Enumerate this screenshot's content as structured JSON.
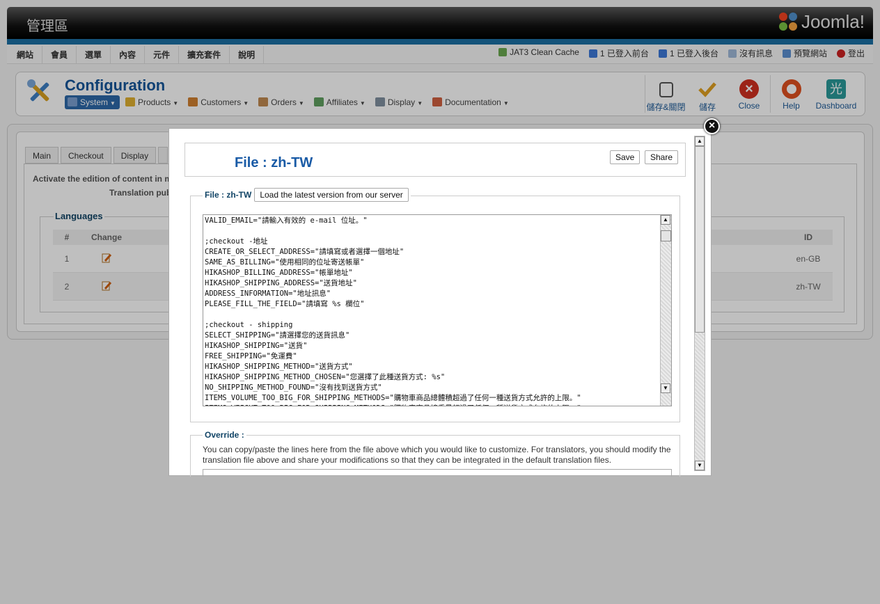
{
  "header": {
    "title": "管理區",
    "logo_text": "Joomla!"
  },
  "menu": [
    "網站",
    "會員",
    "選單",
    "內容",
    "元件",
    "擴充套件",
    "說明"
  ],
  "status": [
    {
      "label": "JAT3 Clean Cache",
      "color": "#6aa84f"
    },
    {
      "label": "1 已登入前台",
      "color": "#3c78d8"
    },
    {
      "label": "1 已登入後台",
      "color": "#3c78d8"
    },
    {
      "label": "沒有訊息",
      "color": "#9fb8d8"
    },
    {
      "label": "預覽網站",
      "color": "#5b8fd0"
    },
    {
      "label": "登出",
      "color": "#cc2222"
    }
  ],
  "config": {
    "title": "Configuration",
    "submenu": [
      {
        "label": "System",
        "active": true,
        "color": "#7a9fd0"
      },
      {
        "label": "Products",
        "active": false,
        "color": "#e0b030"
      },
      {
        "label": "Customers",
        "active": false,
        "color": "#d08030"
      },
      {
        "label": "Orders",
        "active": false,
        "color": "#c08a50"
      },
      {
        "label": "Affiliates",
        "active": false,
        "color": "#60a060"
      },
      {
        "label": "Display",
        "active": false,
        "color": "#8090a0"
      },
      {
        "label": "Documentation",
        "active": false,
        "color": "#d06040"
      }
    ],
    "buttons": [
      {
        "label": "儲存&關閉",
        "icon": "save-close-icon",
        "color": "#555"
      },
      {
        "label": "儲存",
        "icon": "save-icon",
        "color": "#e0a020"
      },
      {
        "label": "Close",
        "icon": "close-icon",
        "color": "#d03020"
      },
      {
        "label": "Help",
        "icon": "help-icon",
        "color": "#e05020"
      },
      {
        "label": "Dashboard",
        "icon": "dashboard-icon",
        "color": "#2a9a9a"
      }
    ]
  },
  "page_tabs": [
    "Main",
    "Checkout",
    "Display",
    ""
  ],
  "panel": {
    "info_line1": "Activate the edition of content in mu",
    "info_line2": "Translation pub",
    "languages_legend": "Languages",
    "columns": {
      "num": "#",
      "change": "Change",
      "id": "ID"
    },
    "rows": [
      {
        "num": "1",
        "id": "en-GB"
      },
      {
        "num": "2",
        "id": "zh-TW"
      }
    ]
  },
  "modal": {
    "file_title": "File : zh-TW",
    "save_label": "Save",
    "share_label": "Share",
    "fieldset_legend": "File : zh-TW",
    "load_latest_label": "Load the latest version from our server",
    "file_content": "VALID_EMAIL=\"請輸入有效的 e-mail 位址。\"\n\n;checkout -地址\nCREATE_OR_SELECT_ADDRESS=\"請填寫或者選擇一個地址\"\nSAME_AS_BILLING=\"使用相同的位址寄送帳單\"\nHIKASHOP_BILLING_ADDRESS=\"帳單地址\"\nHIKASHOP_SHIPPING_ADDRESS=\"送貨地址\"\nADDRESS_INFORMATION=\"地址訊息\"\nPLEASE_FILL_THE_FIELD=\"請填寫 %s 欄位\"\n\n;checkout - shipping\nSELECT_SHIPPING=\"請選擇您的送貨訊息\"\nHIKASHOP_SHIPPING=\"送貨\"\nFREE_SHIPPING=\"免運費\"\nHIKASHOP_SHIPPING_METHOD=\"送貨方式\"\nHIKASHOP_SHIPPING_METHOD_CHOSEN=\"您選擇了此種送貨方式: %s\"\nNO_SHIPPING_METHOD_FOUND=\"沒有找到送貨方式\"\nITEMS_VOLUME_TOO_BIG_FOR_SHIPPING_METHODS=\"購物車商品總體積超過了任何一種送貨方式允許的上限。\"\nITEMS_WEIGHT_TOO_BIG_FOR_SHIPPING_METHODS=\"購物車商品總重量超過了任何一種送貨方式允許的上限。\"",
    "override_legend": "Override :",
    "override_text": "You can copy/paste the lines here from the file above which you would like to customize. For translators, you should modify the translation file above and share your modifications so that they can be integrated in the default translation files."
  }
}
